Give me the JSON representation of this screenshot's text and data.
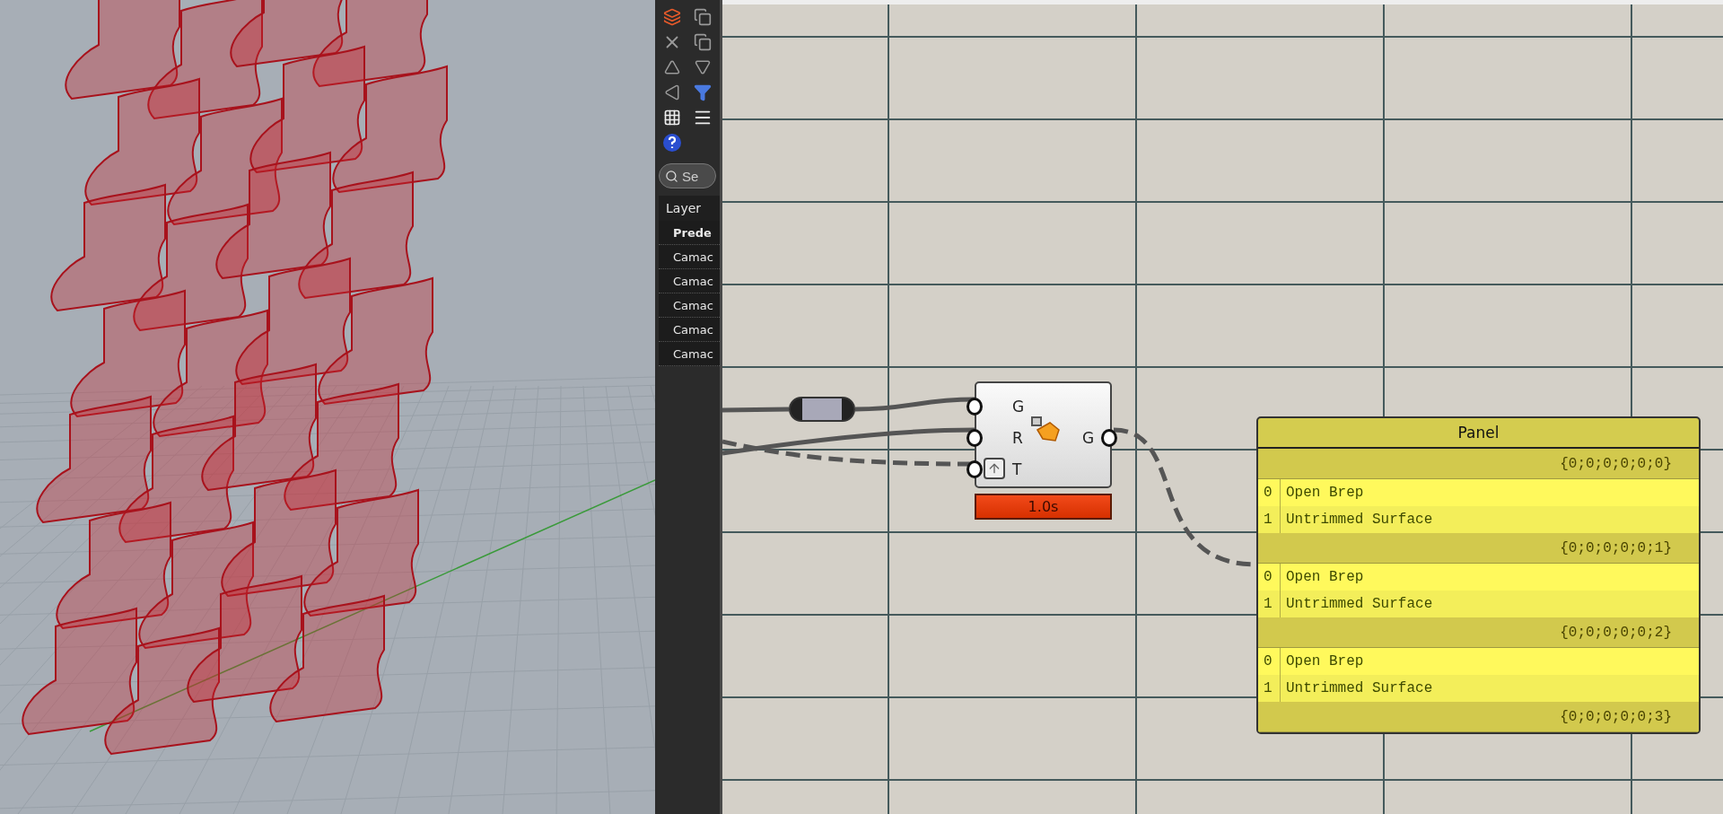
{
  "toolbar": {
    "search": {
      "placeholder": "Se"
    }
  },
  "layers": {
    "header": "Layer",
    "items": [
      {
        "name": "Prede",
        "current": true
      },
      {
        "name": "Camac",
        "current": false
      },
      {
        "name": "Camac",
        "current": false
      },
      {
        "name": "Camac",
        "current": false
      },
      {
        "name": "Camac",
        "current": false
      },
      {
        "name": "Camac",
        "current": false
      }
    ]
  },
  "component": {
    "inputs": [
      "G",
      "R",
      "T"
    ],
    "output": "G",
    "timing": "1.0s"
  },
  "panel": {
    "title": "Panel",
    "branches": [
      {
        "path": "{0;0;0;0;0;0}",
        "items": [
          {
            "index": "0",
            "text": "Open Brep"
          },
          {
            "index": "1",
            "text": "Untrimmed Surface"
          }
        ]
      },
      {
        "path": "{0;0;0;0;0;1}",
        "items": [
          {
            "index": "0",
            "text": "Open Brep"
          },
          {
            "index": "1",
            "text": "Untrimmed Surface"
          }
        ]
      },
      {
        "path": "{0;0;0;0;0;2}",
        "items": [
          {
            "index": "0",
            "text": "Open Brep"
          },
          {
            "index": "1",
            "text": "Untrimmed Surface"
          }
        ]
      },
      {
        "path": "{0;0;0;0;0;3}"
      }
    ]
  }
}
